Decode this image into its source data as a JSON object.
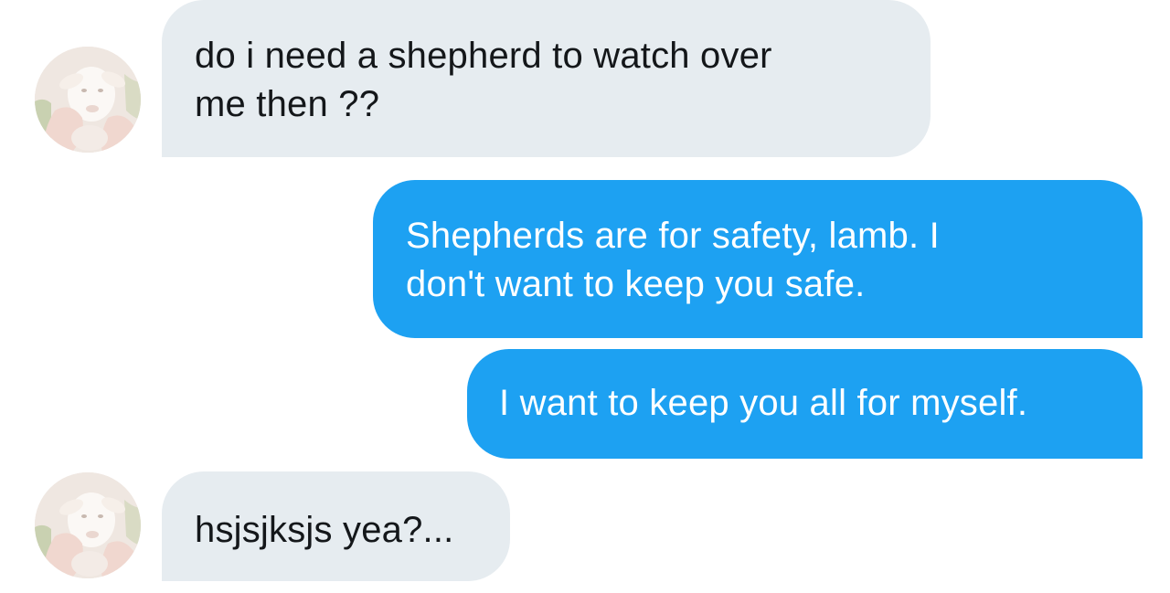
{
  "conversation": {
    "messages": [
      {
        "direction": "received",
        "lines": [
          "do i need a shepherd to watch over",
          "me then ??"
        ]
      },
      {
        "direction": "sent",
        "lines": [
          "Shepherds are for safety, lamb. I",
          "don't want to keep you safe."
        ]
      },
      {
        "direction": "sent",
        "lines": [
          "I want to keep you all for myself."
        ]
      },
      {
        "direction": "received",
        "lines": [
          "hsjsjksjs yea?..."
        ]
      }
    ]
  },
  "colors": {
    "sent_bubble": "#1da1f2",
    "received_bubble": "#e6ecf0",
    "background": "#ffffff"
  },
  "icons": {
    "contact_avatar": "lamb-avatar-icon"
  }
}
